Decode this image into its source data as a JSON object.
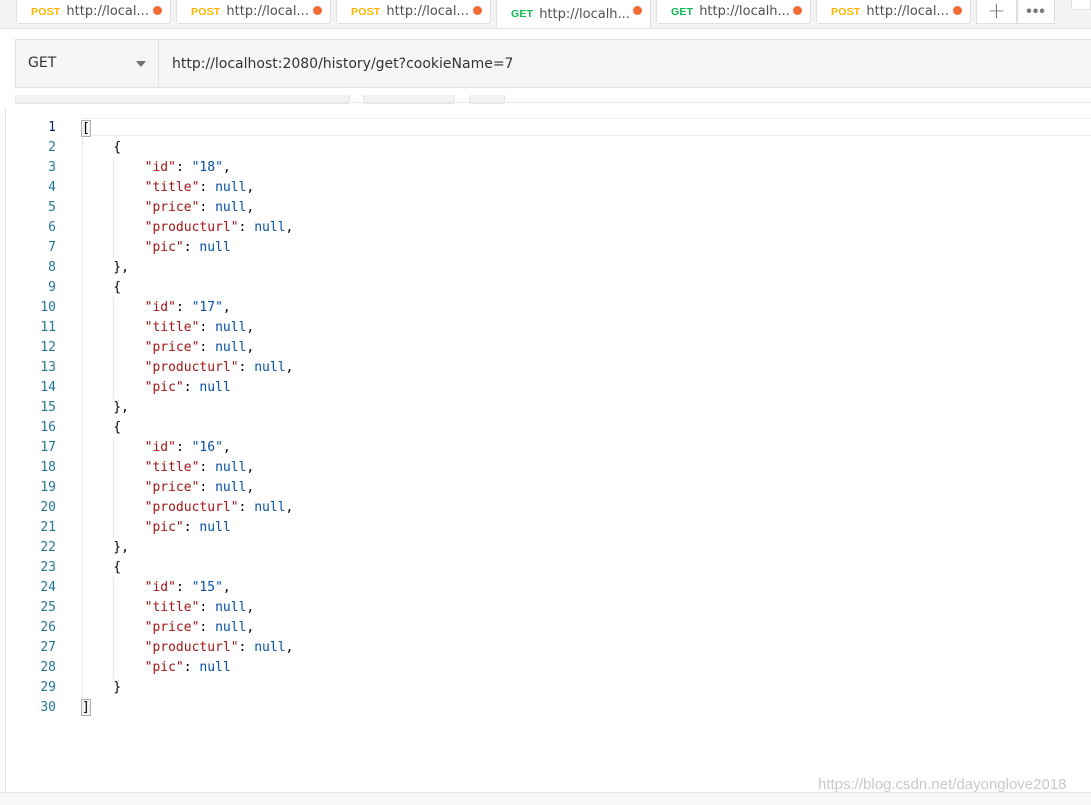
{
  "tabs": [
    {
      "method": "POST",
      "url": "http://local...",
      "unsaved": true
    },
    {
      "method": "POST",
      "url": "http://local...",
      "unsaved": true
    },
    {
      "method": "POST",
      "url": "http://local...",
      "unsaved": true
    },
    {
      "method": "GET",
      "url": "http://localh...",
      "unsaved": true,
      "active": true
    },
    {
      "method": "GET",
      "url": "http://localh...",
      "unsaved": true
    },
    {
      "method": "POST",
      "url": "http://local...",
      "unsaved": true
    }
  ],
  "tab_actions": {
    "new_tab_icon": "plus-icon",
    "more_icon": "more-horizontal-icon"
  },
  "request": {
    "method": "GET",
    "url": "http://localhost:2080/history/get?cookieName=7"
  },
  "response": {
    "records": [
      {
        "id": "18",
        "title": null,
        "price": null,
        "producturl": null,
        "pic": null
      },
      {
        "id": "17",
        "title": null,
        "price": null,
        "producturl": null,
        "pic": null
      },
      {
        "id": "16",
        "title": null,
        "price": null,
        "producturl": null,
        "pic": null
      },
      {
        "id": "15",
        "title": null,
        "price": null,
        "producturl": null,
        "pic": null
      }
    ],
    "field_order": [
      "id",
      "title",
      "price",
      "producturl",
      "pic"
    ]
  },
  "watermark": "https://blog.csdn.net/dayonglove2018",
  "colors": {
    "post": "#ffb400",
    "get": "#0cbb52",
    "unsaved_dot": "#f26b3a",
    "json_key": "#a31515",
    "json_value": "#0451a5",
    "line_number": "#237893"
  }
}
